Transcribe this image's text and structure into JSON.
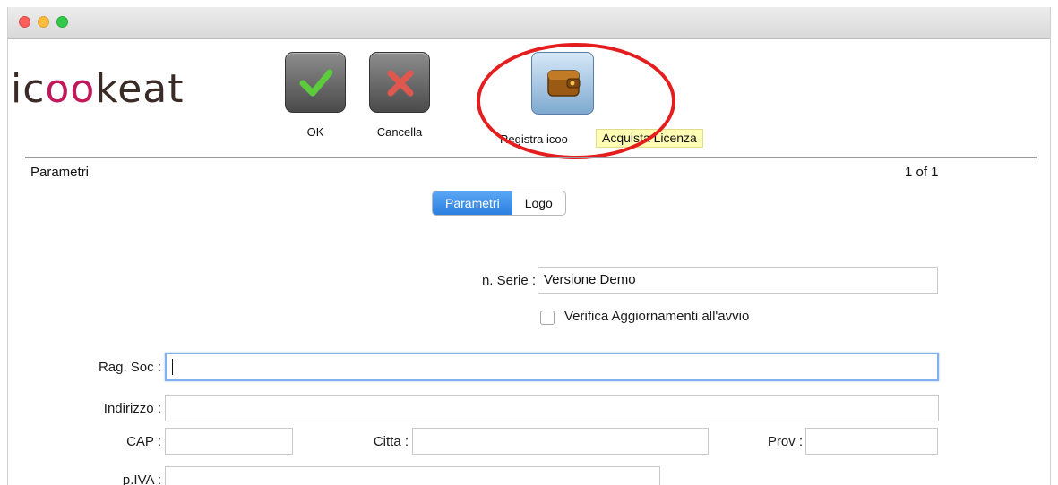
{
  "logo": {
    "part1": "ic",
    "part2": "oo",
    "part3": "k",
    "part4": "eat"
  },
  "toolbar": {
    "ok_label": "OK",
    "cancel_label": "Cancella",
    "register_label": "Registra icoo",
    "tooltip": "Acquista Licenza"
  },
  "header": {
    "section_title": "Parametri",
    "page_counter": "1 of 1"
  },
  "tabs": [
    {
      "label": "Parametri",
      "active": true
    },
    {
      "label": "Logo",
      "active": false
    }
  ],
  "form": {
    "serie_label": "n. Serie :",
    "serie_value": "Versione Demo",
    "verify_label": "Verifica Aggiornamenti all'avvio",
    "verify_checked": false,
    "ragsoc_label": "Rag. Soc :",
    "ragsoc_value": "",
    "indirizzo_label": "Indirizzo :",
    "indirizzo_value": "",
    "cap_label": "CAP :",
    "cap_value": "",
    "citta_label": "Citta :",
    "citta_value": "",
    "prov_label": "Prov :",
    "prov_value": "",
    "piva_label": "p.IVA :",
    "piva_value": ""
  },
  "colors": {
    "accent": "#2b7fe0",
    "annotation": "#e41e1e",
    "tooltip_bg": "#fffcb4"
  },
  "icons": [
    "checkmark-icon",
    "cross-icon",
    "wallet-icon"
  ]
}
